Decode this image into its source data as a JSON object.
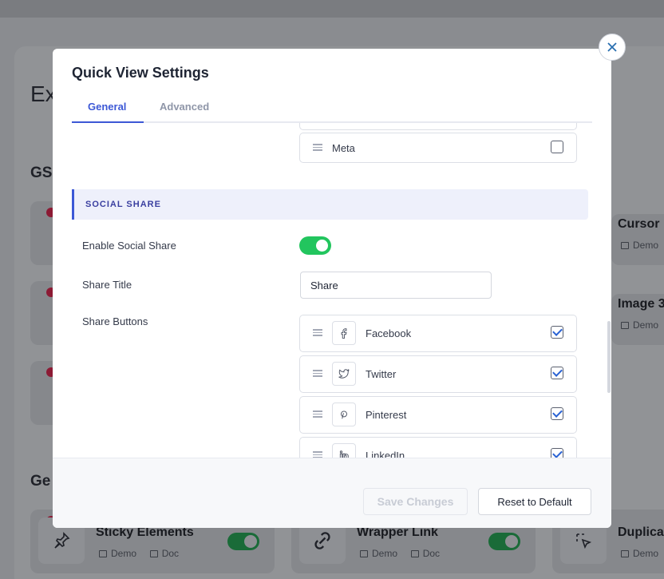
{
  "background": {
    "heading_partial": "Ex",
    "section_gs": "GS",
    "section_ge": "Ge",
    "cards": [
      {
        "title": "Cursor",
        "meta": "Demo"
      },
      {
        "title": "Image 3",
        "meta": "Demo"
      },
      {
        "title": "Sticky Elements",
        "demo": "Demo",
        "doc": "Doc"
      },
      {
        "title": "Wrapper Link",
        "demo": "Demo",
        "doc": "Doc"
      },
      {
        "title": "Duplica",
        "meta": "Demo"
      }
    ]
  },
  "modal": {
    "title": "Quick View Settings",
    "tabs": [
      {
        "label": "General",
        "active": true
      },
      {
        "label": "Advanced",
        "active": false
      }
    ],
    "meta_item": {
      "label": "Meta",
      "checked": false
    },
    "section": {
      "title": "SOCIAL SHARE"
    },
    "fields": {
      "enable_label": "Enable Social Share",
      "enable_value": true,
      "share_title_label": "Share Title",
      "share_title_value": "Share",
      "share_buttons_label": "Share Buttons"
    },
    "share_buttons": [
      {
        "label": "Facebook",
        "icon": "facebook-icon",
        "checked": true
      },
      {
        "label": "Twitter",
        "icon": "twitter-icon",
        "checked": true
      },
      {
        "label": "Pinterest",
        "icon": "pinterest-icon",
        "checked": true
      },
      {
        "label": "LinkedIn",
        "icon": "linkedin-icon",
        "checked": true
      }
    ],
    "footer": {
      "save_label": "Save Changes",
      "reset_label": "Reset to Default"
    }
  },
  "colors": {
    "accent": "#3c58d6",
    "toggle_on": "#22c55e",
    "section_bg": "#eef0fb"
  }
}
